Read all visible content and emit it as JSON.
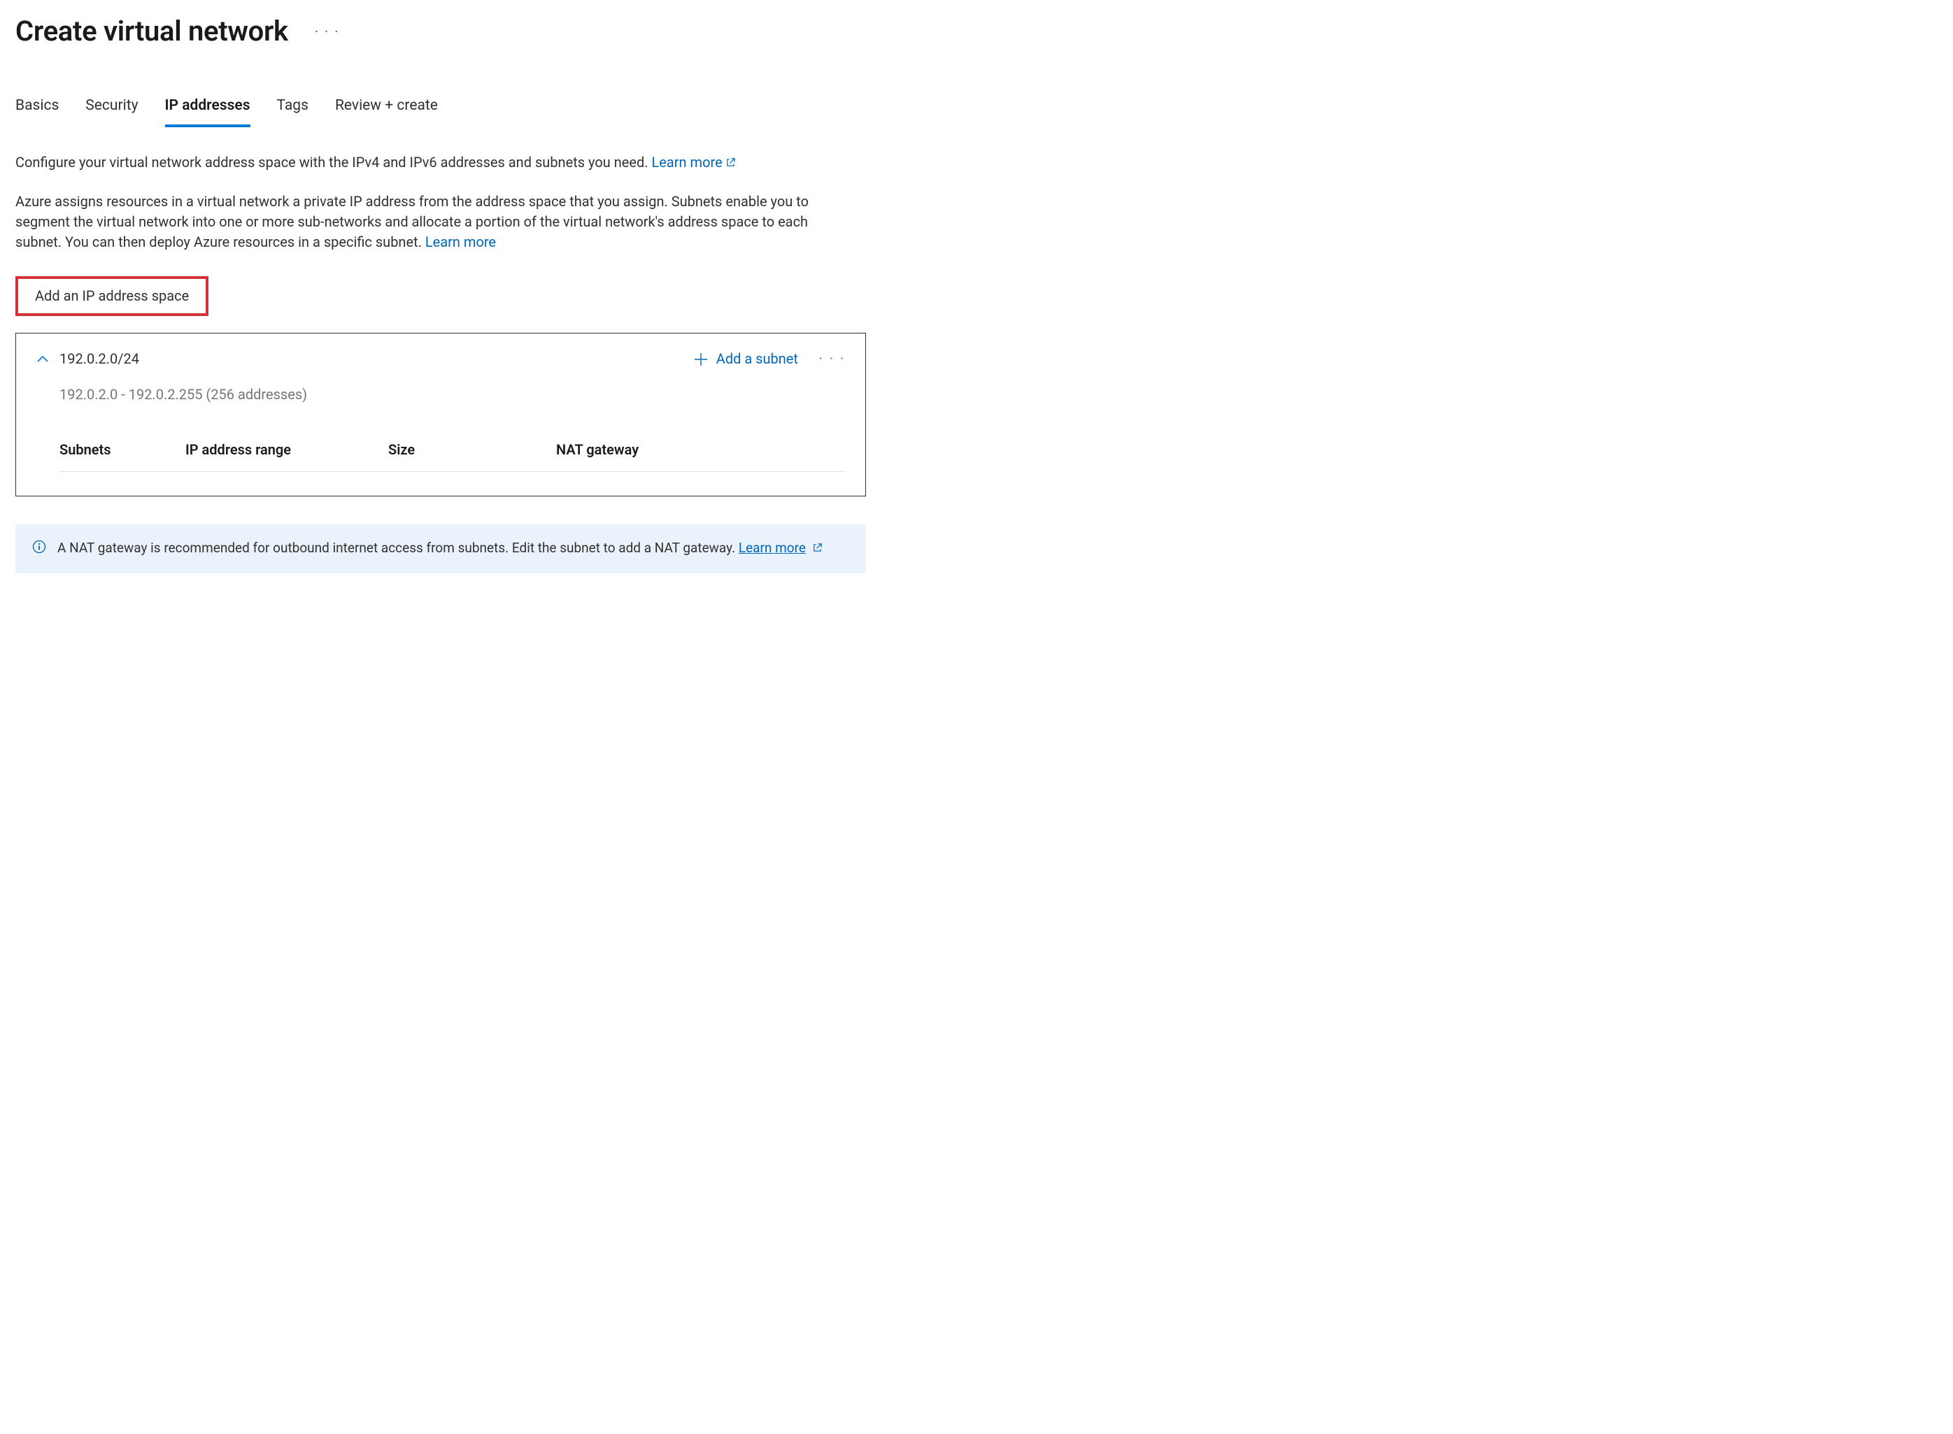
{
  "header": {
    "title": "Create virtual network"
  },
  "tabs": [
    {
      "label": "Basics",
      "active": false
    },
    {
      "label": "Security",
      "active": false
    },
    {
      "label": "IP addresses",
      "active": true
    },
    {
      "label": "Tags",
      "active": false
    },
    {
      "label": "Review + create",
      "active": false
    }
  ],
  "intro": {
    "line1_pre": "Configure your virtual network address space with the IPv4 and IPv6 addresses and subnets you need. ",
    "learn_more": "Learn more",
    "line2_pre": "Azure assigns resources in a virtual network a private IP address from the address space that you assign. Subnets enable you to segment the virtual network into one or more sub-networks and allocate a portion of the virtual network's address space to each subnet. You can then deploy Azure resources in a specific subnet. "
  },
  "add_space_button": "Add an IP address space",
  "address_space": {
    "cidr": "192.0.2.0/24",
    "range": "192.0.2.0 - 192.0.2.255 (256 addresses)",
    "add_subnet_label": "Add a subnet",
    "columns": {
      "subnets": "Subnets",
      "ip_range": "IP address range",
      "size": "Size",
      "nat": "NAT gateway"
    }
  },
  "info": {
    "text": "A NAT gateway is recommended for outbound internet access from subnets. Edit the subnet to add a NAT gateway.  ",
    "learn_more": "Learn more"
  }
}
